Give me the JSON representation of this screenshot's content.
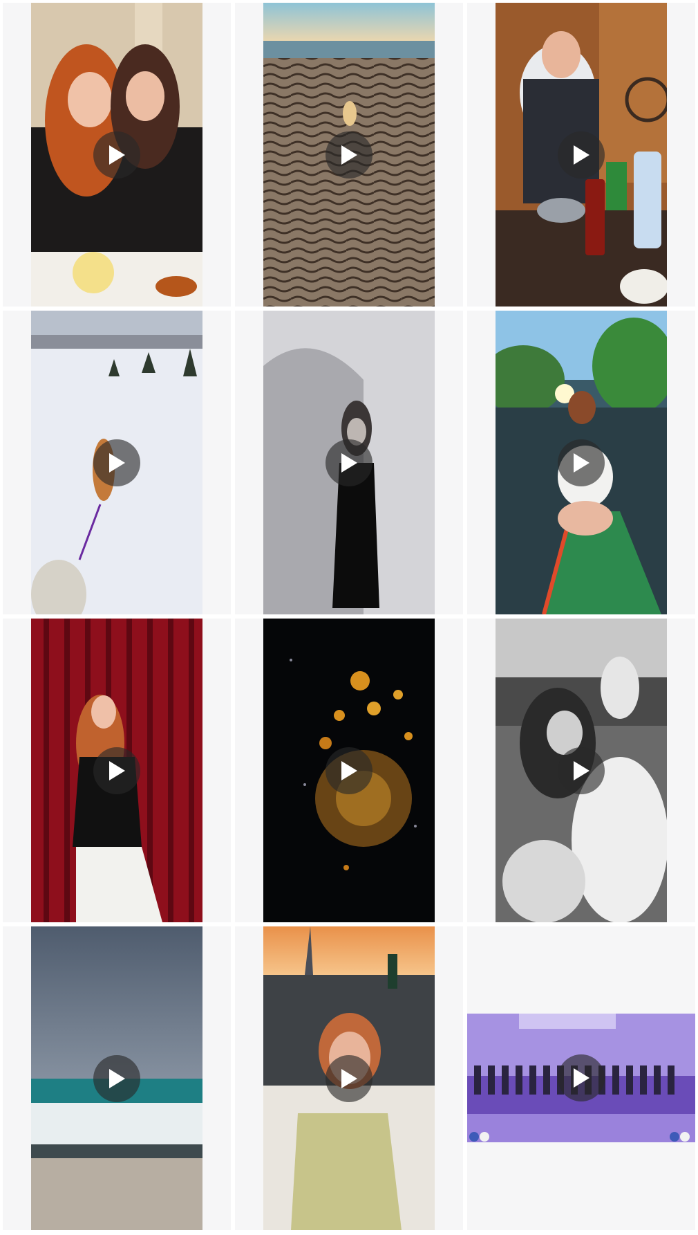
{
  "gallery": {
    "videos": [
      {
        "scene": "two-women-dinner",
        "icon": "play-icon"
      },
      {
        "scene": "dog-running-on-sand-beach",
        "icon": "play-icon"
      },
      {
        "scene": "man-cooking-in-kitchen",
        "icon": "play-icon"
      },
      {
        "scene": "dog-in-snow",
        "icon": "play-icon"
      },
      {
        "scene": "woman-black-dress-arch",
        "icon": "play-icon"
      },
      {
        "scene": "woman-on-paddleboard",
        "icon": "play-icon"
      },
      {
        "scene": "woman-red-curtain",
        "icon": "play-icon"
      },
      {
        "scene": "fireworks-night",
        "icon": "play-icon"
      },
      {
        "scene": "woman-with-borzoi-bw",
        "icon": "play-icon"
      },
      {
        "scene": "sea-waves-cloudy",
        "icon": "play-icon"
      },
      {
        "scene": "woman-boat-sunset",
        "icon": "play-icon"
      },
      {
        "scene": "choir-on-stage",
        "icon": "play-icon"
      }
    ]
  },
  "colors": {
    "cell_background": "#f6f6f7",
    "play_button": "rgba(40,40,40,0.62)",
    "play_glyph": "#ffffff"
  }
}
